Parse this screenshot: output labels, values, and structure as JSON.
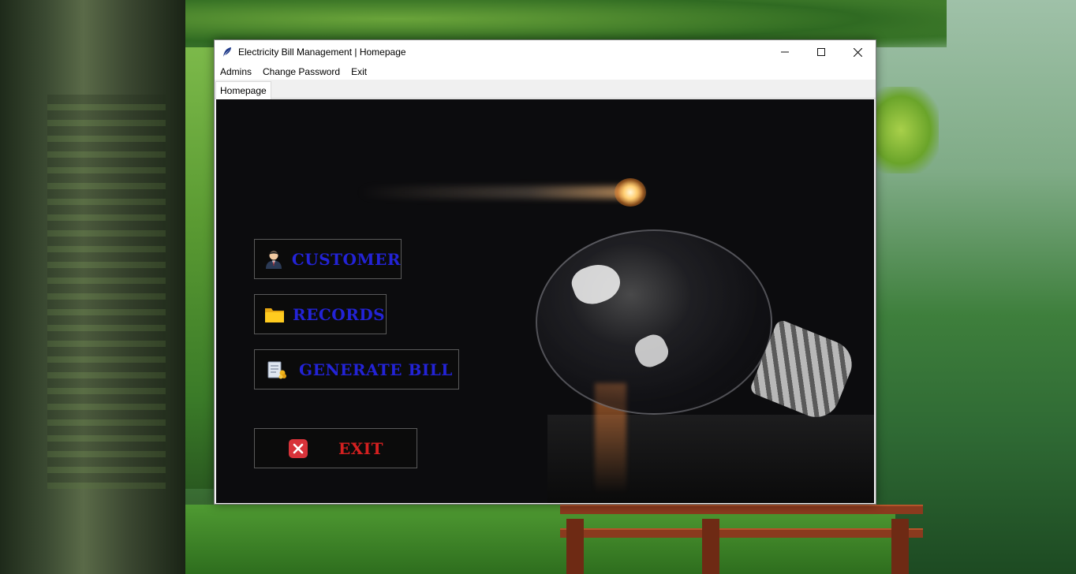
{
  "window": {
    "title": "Electricity Bill Management | Homepage",
    "controls": {
      "minimize": "—",
      "maximize": "☐",
      "close": "✕"
    }
  },
  "menu": {
    "items": [
      "Admins",
      "Change Password",
      "Exit"
    ]
  },
  "tabs": [
    "Homepage"
  ],
  "buttons": {
    "customer": {
      "label": "CUSTOMER",
      "icon": "customer-icon"
    },
    "records": {
      "label": "RECORDS",
      "icon": "folder-icon"
    },
    "generate_bill": {
      "label": "GENERATE BILL",
      "icon": "bill-icon"
    },
    "exit": {
      "label": "EXIT",
      "icon": "close-icon"
    }
  },
  "colors": {
    "nav_label": "#2323d6",
    "exit_label": "#d42020",
    "content_bg": "#0c0c0e"
  }
}
